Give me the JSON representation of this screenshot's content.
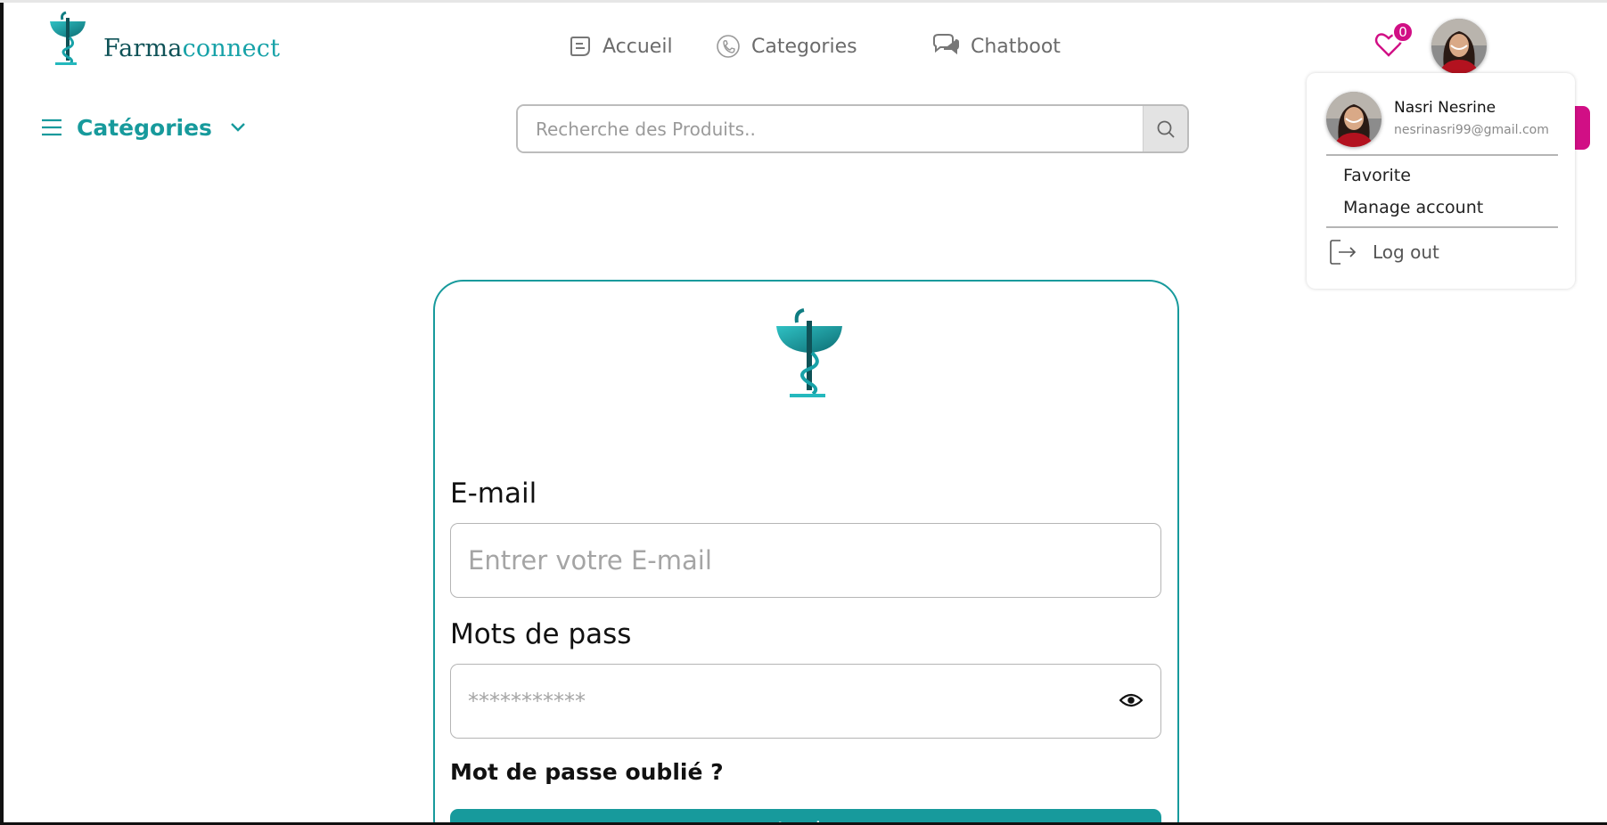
{
  "brand": {
    "name_part1": "Farma",
    "name_part2": "connect",
    "primary_color": "#179a9c",
    "accent_color": "#d10f85"
  },
  "nav": {
    "items": [
      {
        "label": "Accueil",
        "icon": "home-chat-icon"
      },
      {
        "label": "Categories",
        "icon": "medical-categories-icon"
      },
      {
        "label": "Chatboot",
        "icon": "chat-bubbles-icon"
      }
    ]
  },
  "favorites": {
    "count": "0",
    "icon": "heart-icon"
  },
  "categories_menu": {
    "label": "Catégories"
  },
  "search": {
    "placeholder": "Recherche des Produits..",
    "value": ""
  },
  "user_menu": {
    "name": "Nasri Nesrine",
    "email": "nesrinasri99@gmail.com",
    "items": [
      "Favorite",
      "Manage account"
    ],
    "logout_label": "Log out"
  },
  "login_form": {
    "email_label": "E-mail",
    "email_placeholder": "Entrer votre E-mail",
    "password_label": "Mots de pass",
    "password_placeholder": "***********",
    "forgot_label": "Mot de passe oublié ?",
    "submit_label": "Login"
  }
}
